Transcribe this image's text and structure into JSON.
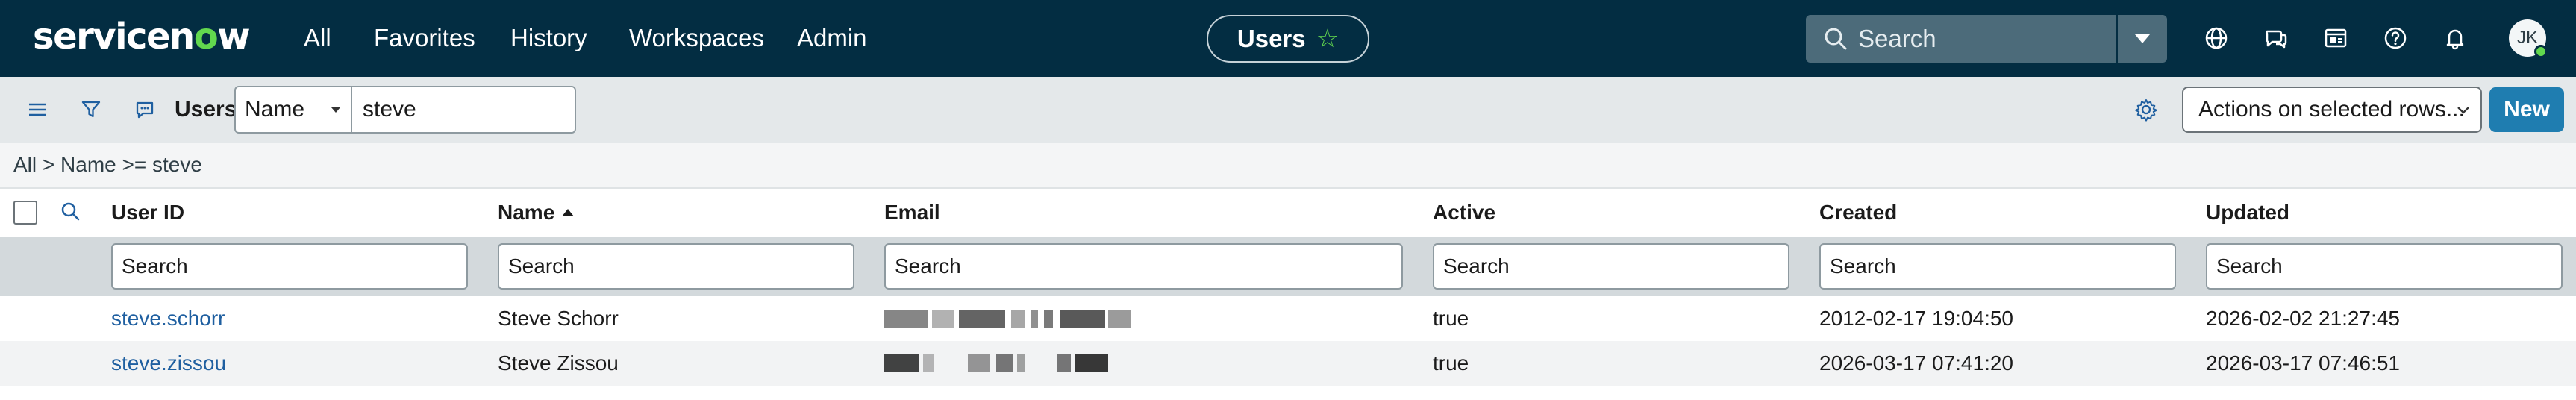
{
  "topnav": {
    "logo_prefix": "servicen",
    "logo_o": "o",
    "logo_suffix": "w",
    "menu": [
      "All",
      "Favorites",
      "History",
      "Workspaces",
      "Admin"
    ],
    "context_pill": "Users",
    "search_placeholder": "Search",
    "user_initials": "JK",
    "icons": [
      "globe-icon",
      "chat-icon",
      "scratchpad-icon",
      "help-icon",
      "notifications-icon"
    ]
  },
  "toolbar": {
    "list_title": "Users",
    "field_select_value": "Name",
    "field_input_value": "steve",
    "actions_label": "Actions on selected rows...",
    "new_label": "New"
  },
  "breadcrumb": "All > Name >= steve",
  "table": {
    "columns": [
      "User ID",
      "Name",
      "Email",
      "Active",
      "Created",
      "Updated"
    ],
    "sorted_column": "Name",
    "sort_direction": "ascending",
    "search_placeholder": "Search",
    "rows": [
      {
        "user_id": "steve.schorr",
        "name": "Steve Schorr",
        "email": "",
        "active": "true",
        "created": "2012-02-17 19:04:50",
        "updated": "2026-02-02 21:27:45"
      },
      {
        "user_id": "steve.zissou",
        "name": "Steve Zissou",
        "email": "",
        "active": "true",
        "created": "2026-03-17 07:41:20",
        "updated": "2026-03-17 07:46:51"
      }
    ]
  },
  "colors": {
    "nav_bg": "#032d42",
    "brand_green": "#62d84e",
    "toolbar_bg": "#e4e8ea",
    "primary_button": "#1f7db0",
    "link": "#1f5fa0"
  }
}
